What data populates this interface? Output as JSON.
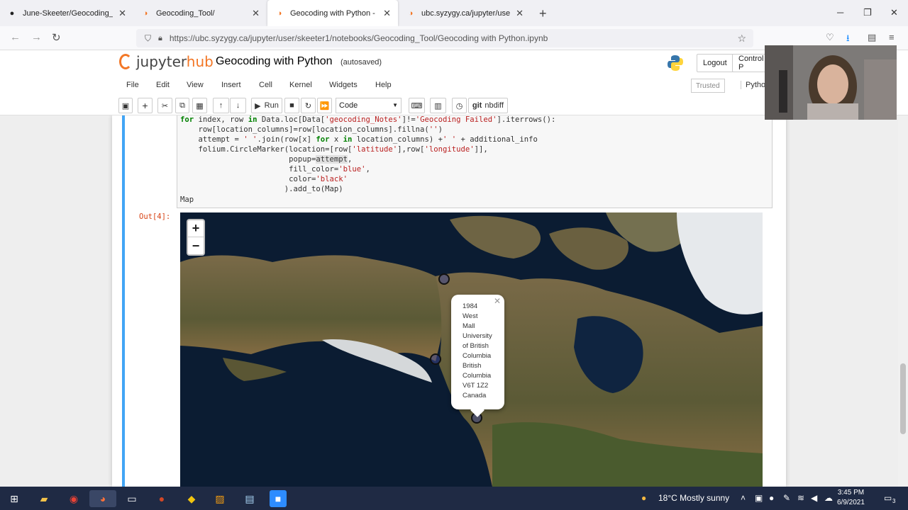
{
  "browser": {
    "tabs": [
      {
        "title": "June-Skeeter/Geocoding_Tool",
        "icon": "github-icon"
      },
      {
        "title": "Geocoding_Tool/",
        "icon": "jupyter-icon"
      },
      {
        "title": "Geocoding with Python - Jupyte",
        "icon": "jupyter-icon"
      },
      {
        "title": "ubc.syzygy.ca/jupyter/user/skee",
        "icon": "jupyter-icon"
      }
    ],
    "url": "https://ubc.syzygy.ca/jupyter/user/skeeter1/notebooks/Geocoding_Tool/Geocoding with Python.ipynb"
  },
  "jupyter": {
    "logo_text": "jupyter",
    "logo_hub": "hub",
    "notebook_title": "Geocoding with Python",
    "save_status": "(autosaved)",
    "logout_label": "Logout",
    "control_panel_label": "Control P",
    "menu": [
      "File",
      "Edit",
      "View",
      "Insert",
      "Cell",
      "Kernel",
      "Widgets",
      "Help"
    ],
    "trusted_label": "Trusted",
    "kernel_label": "Pytho",
    "toolbar": {
      "run_label": "Run",
      "cell_type": "Code",
      "nbdiff_label": "nbdiff"
    }
  },
  "code_cell": {
    "output_prompt": "Out[4]:",
    "last_line": "Map"
  },
  "map_popup": {
    "lines": [
      "1984",
      "West",
      "Mall",
      "University",
      "of British",
      "Columbia",
      "British",
      "Columbia",
      "V6T 1Z2",
      "Canada"
    ]
  },
  "taskbar": {
    "weather": "18°C  Mostly sunny",
    "time": "3:45 PM",
    "date": "6/9/2021",
    "notifications": "3"
  },
  "colors": {
    "jupyter_orange": "#f37726",
    "cell_selected_bar": "#42a5f5",
    "out_prompt": "#d84315",
    "taskbar": "#1f2a44"
  }
}
